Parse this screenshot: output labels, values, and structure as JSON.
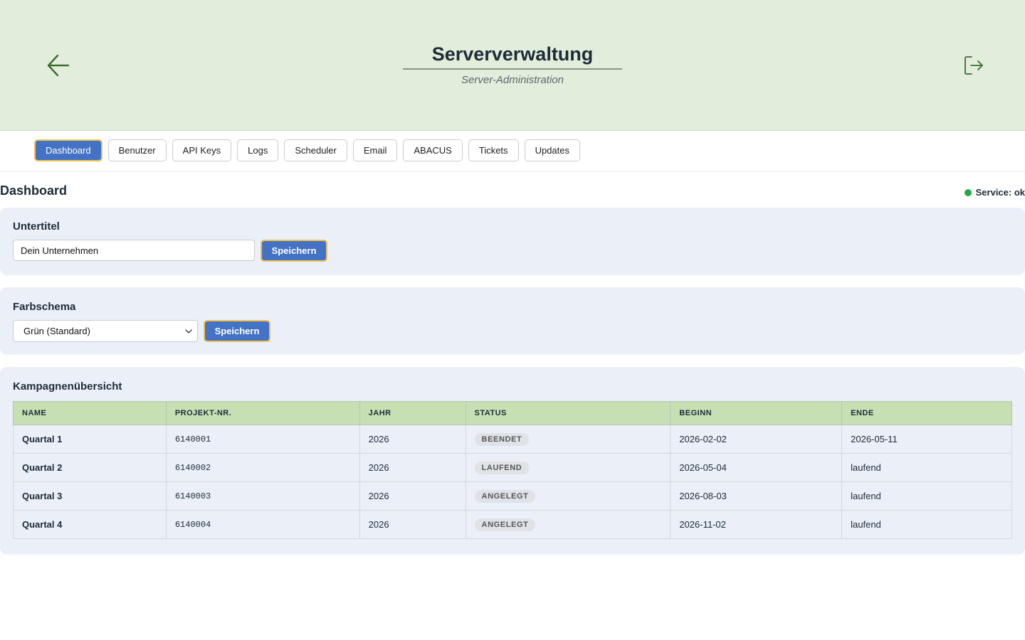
{
  "header": {
    "title": "Serververwaltung",
    "subtitle": "Server-Administration",
    "back_icon": "arrow-left-icon",
    "logout_icon": "logout-icon",
    "background": "#e2eedb"
  },
  "nav": {
    "tabs": [
      {
        "label": "Dashboard",
        "active": true
      },
      {
        "label": "Benutzer",
        "active": false
      },
      {
        "label": "API Keys",
        "active": false
      },
      {
        "label": "Logs",
        "active": false
      },
      {
        "label": "Scheduler",
        "active": false
      },
      {
        "label": "Email",
        "active": false
      },
      {
        "label": "ABACUS",
        "active": false
      },
      {
        "label": "Tickets",
        "active": false
      },
      {
        "label": "Updates",
        "active": false
      }
    ]
  },
  "page": {
    "title": "Dashboard",
    "service_status": "Service: ok",
    "service_status_color": "#22a84a"
  },
  "subtitle_card": {
    "title": "Untertitel",
    "input_value": "Dein Unternehmen",
    "save_label": "Speichern"
  },
  "color_card": {
    "title": "Farbschema",
    "selected": "Grün (Standard)",
    "save_label": "Speichern"
  },
  "campaigns": {
    "title": "Kampagnenübersicht",
    "columns": [
      "NAME",
      "PROJEKT-NR.",
      "JAHR",
      "STATUS",
      "BEGINN",
      "ENDE"
    ],
    "rows": [
      {
        "name": "Quartal 1",
        "project": "6140001",
        "year": "2026",
        "status": "BEENDET",
        "begin": "2026-02-02",
        "end": "2026-05-11"
      },
      {
        "name": "Quartal 2",
        "project": "6140002",
        "year": "2026",
        "status": "LAUFEND",
        "begin": "2026-05-04",
        "end": "laufend"
      },
      {
        "name": "Quartal 3",
        "project": "6140003",
        "year": "2026",
        "status": "ANGELEGT",
        "begin": "2026-08-03",
        "end": "laufend"
      },
      {
        "name": "Quartal 4",
        "project": "6140004",
        "year": "2026",
        "status": "ANGELEGT",
        "begin": "2026-11-02",
        "end": "laufend"
      }
    ]
  },
  "colors": {
    "accent": "#4472c4",
    "focus_border": "#f2c14e",
    "table_header": "#c6e0b4",
    "card_bg": "#eaeff8"
  }
}
